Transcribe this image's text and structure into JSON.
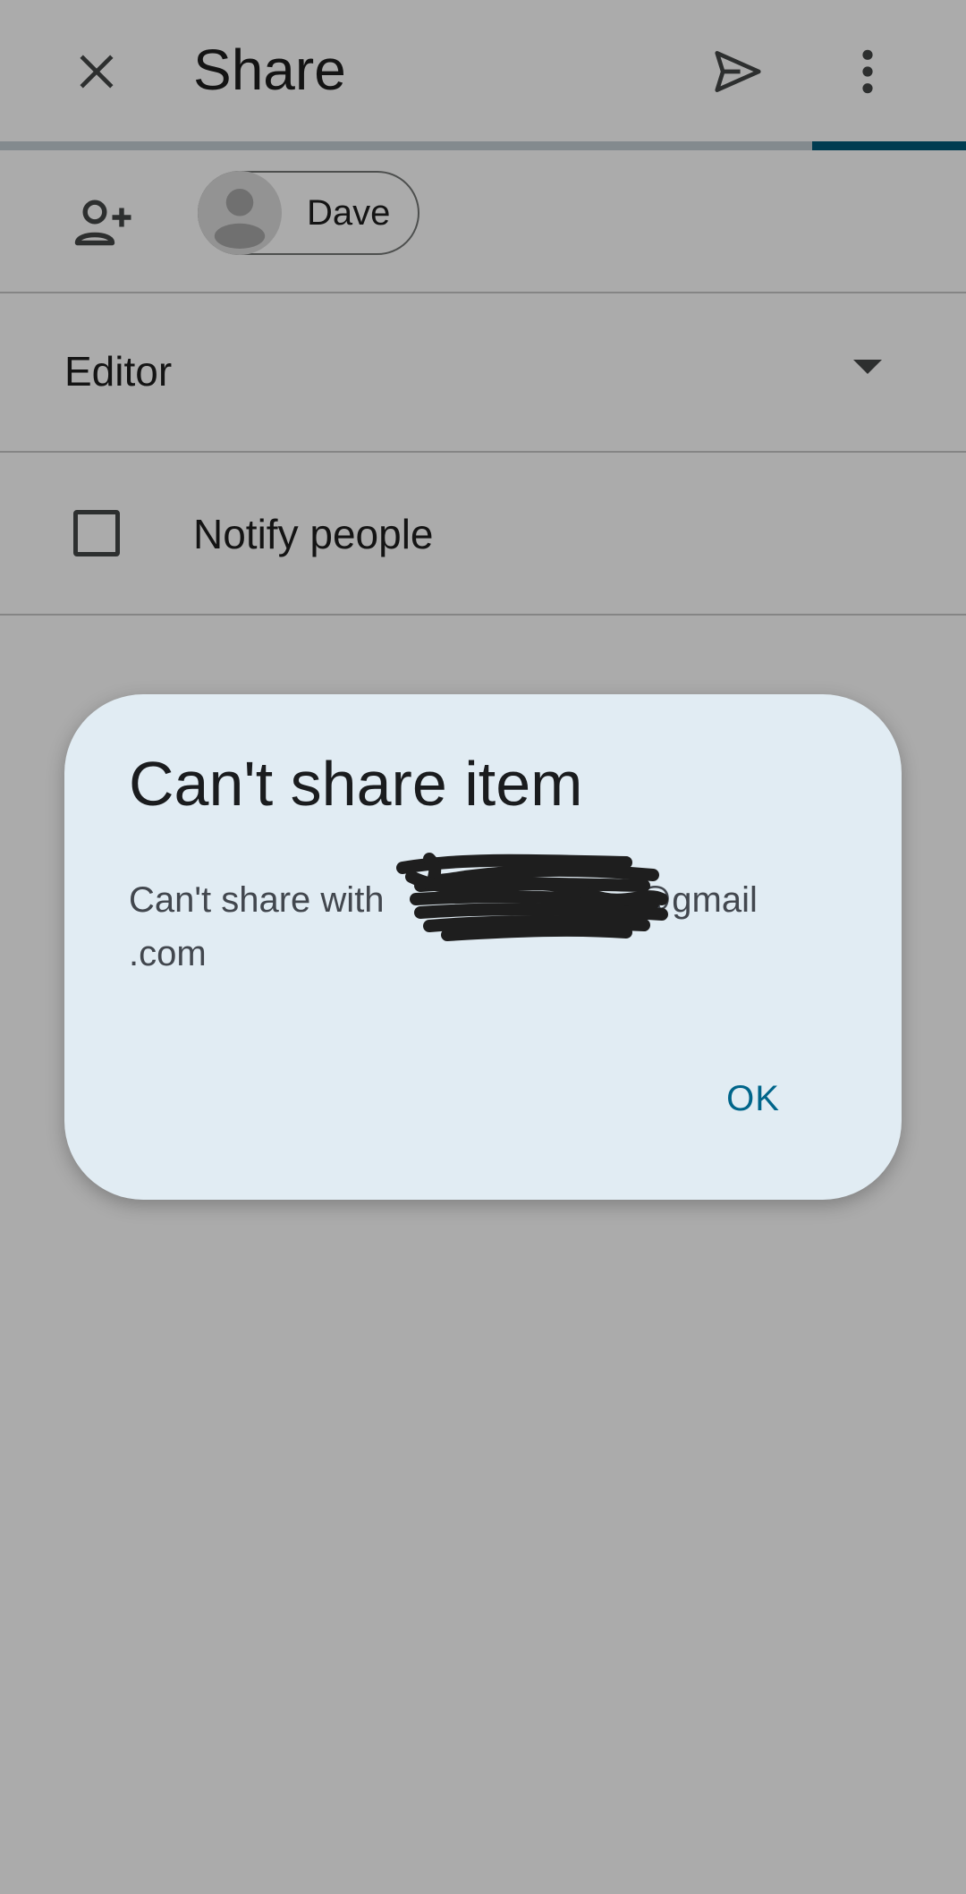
{
  "app_bar": {
    "title": "Share",
    "close_icon": "close-icon",
    "send_icon": "send-icon",
    "more_icon": "more-vert-icon"
  },
  "recipients": {
    "add_icon": "person-add-icon",
    "chips": [
      {
        "label": "Dave",
        "avatar_icon": "person-icon"
      }
    ]
  },
  "role": {
    "selected": "Editor",
    "dropdown_icon": "arrow-drop-down-icon"
  },
  "notify": {
    "label": "Notify people",
    "checked": false
  },
  "dialog": {
    "title": "Can't share item",
    "message_prefix": "Can't share with ",
    "message_suffix": "@gmail .com",
    "ok_label": "OK"
  },
  "colors": {
    "accent": "#00658a",
    "progress": "#005a7a",
    "dialog_bg": "#e1ecf3",
    "redaction": "#1e1e1e"
  }
}
